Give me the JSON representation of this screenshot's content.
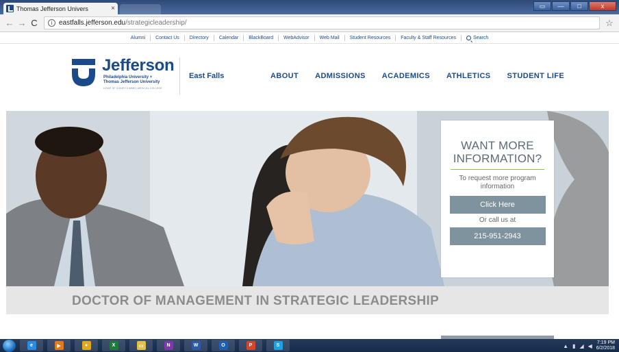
{
  "browser": {
    "tab_title": "Thomas Jefferson Univers",
    "tab_close": "×",
    "url_host": "eastfalls.jefferson.edu",
    "url_path": "/strategicleadership/",
    "back_glyph": "←",
    "forward_glyph": "→",
    "reload_glyph": "C",
    "info_glyph": "i",
    "star_glyph": "☆",
    "window_buttons": [
      "▭",
      "—",
      "□",
      "x"
    ]
  },
  "utility_nav": {
    "items": [
      "Alumni",
      "Contact Us",
      "Directory",
      "Calendar",
      "BlackBoard",
      "WebAdvisor",
      "Web Mail",
      "Student Resources",
      "Faculty & Staff Resources"
    ],
    "search_label": "Search"
  },
  "header": {
    "logo_word": "Jefferson",
    "logo_sub1": "Philadelphia University +",
    "logo_sub2": "Thomas Jefferson University",
    "logo_tag": "HOME OF SIDNEY KIMMEL MEDICAL COLLEGE",
    "campus": "East Falls",
    "nav": [
      "ABOUT",
      "ADMISSIONS",
      "ACADEMICS",
      "ATHLETICS",
      "STUDENT LIFE"
    ]
  },
  "info_card": {
    "heading_line1": "WANT MORE",
    "heading_line2": "INFORMATION?",
    "text": "To request more program information",
    "button_label": "Click Here",
    "or_text": "Or call us at",
    "phone": "215-951-2943"
  },
  "page": {
    "title": "DOCTOR OF MANAGEMENT IN STRATEGIC LEADERSHIP"
  },
  "taskbar": {
    "apps": [
      {
        "name": "ie",
        "label": "e",
        "color": "#2a8be0"
      },
      {
        "name": "media",
        "label": "▶",
        "color": "#e07a1f"
      },
      {
        "name": "chrome",
        "label": "●",
        "color": "#e0a81f"
      },
      {
        "name": "excel",
        "label": "X",
        "color": "#1f7a3c"
      },
      {
        "name": "explorer",
        "label": "▭",
        "color": "#e0c24a"
      },
      {
        "name": "onenote",
        "label": "N",
        "color": "#7a3aa8"
      },
      {
        "name": "word",
        "label": "W",
        "color": "#2a5aa8"
      },
      {
        "name": "outlook",
        "label": "O",
        "color": "#1f5fb0"
      },
      {
        "name": "powerpoint",
        "label": "P",
        "color": "#d2472b"
      },
      {
        "name": "skype",
        "label": "S",
        "color": "#1fa0e0"
      }
    ],
    "time": "7:19 PM",
    "date": "6/2/2018"
  }
}
